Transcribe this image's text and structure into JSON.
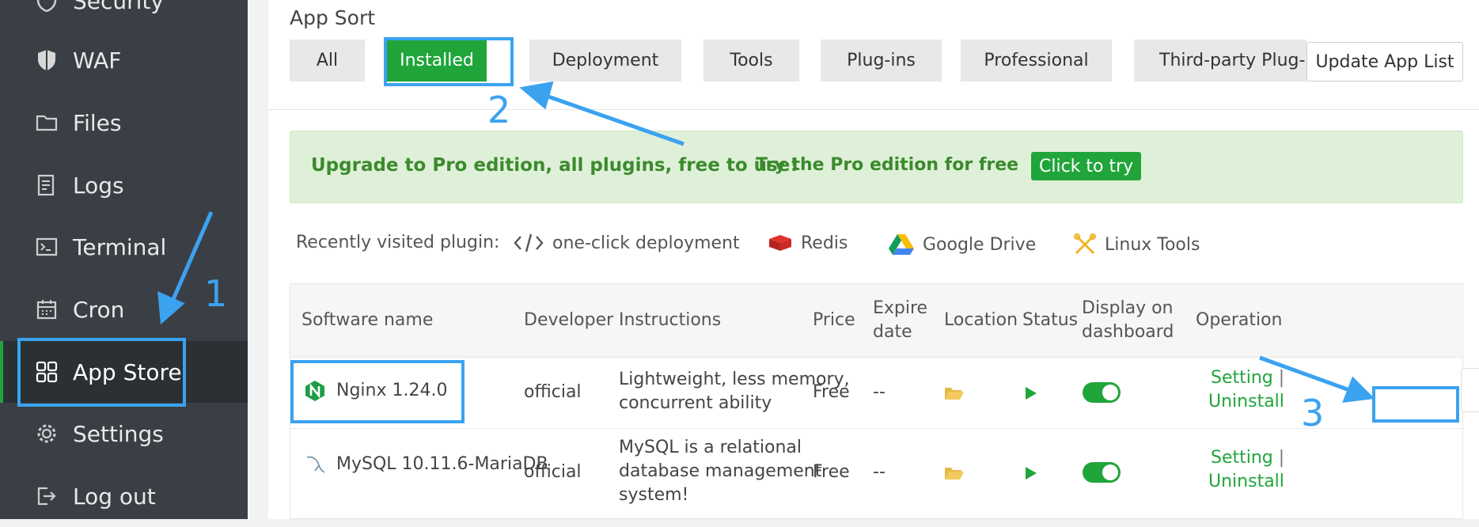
{
  "sidebar": {
    "items": [
      {
        "label": "Security",
        "icon": "shield-icon"
      },
      {
        "label": "WAF",
        "icon": "waf-shield-icon"
      },
      {
        "label": "Files",
        "icon": "folder-icon"
      },
      {
        "label": "Logs",
        "icon": "log-icon"
      },
      {
        "label": "Terminal",
        "icon": "terminal-icon"
      },
      {
        "label": "Cron",
        "icon": "calendar-icon"
      },
      {
        "label": "App Store",
        "icon": "grid-icon",
        "active": true
      },
      {
        "label": "Settings",
        "icon": "gear-icon"
      },
      {
        "label": "Log out",
        "icon": "logout-icon"
      }
    ]
  },
  "app_sort": {
    "title": "App Sort",
    "categories": [
      "All",
      "Installed",
      "Deployment",
      "Tools",
      "Plug-ins",
      "Professional",
      "Third-party Plug-in"
    ],
    "active_category": "Installed",
    "update_label": "Update App List"
  },
  "promo": {
    "headline": "Upgrade to Pro edition, all plugins, free to use!",
    "subtext": "Try the Pro edition for free",
    "button": "Click to try"
  },
  "recent": {
    "label": "Recently visited plugin:",
    "items": [
      {
        "name": "one-click deployment",
        "icon": "code-icon"
      },
      {
        "name": "Redis",
        "icon": "redis-icon"
      },
      {
        "name": "Google Drive",
        "icon": "google-drive-icon"
      },
      {
        "name": "Linux Tools",
        "icon": "tools-icon"
      }
    ]
  },
  "table": {
    "headers": {
      "name": "Software name",
      "developer": "Developer",
      "instructions": "Instructions",
      "price": "Price",
      "expire_1": "Expire",
      "expire_2": "date",
      "location": "Location",
      "status": "Status",
      "display_1": "Display on",
      "display_2": "dashboard",
      "operation": "Operation"
    },
    "rows": [
      {
        "name": "Nginx 1.24.0",
        "icon": "nginx-icon",
        "developer": "official",
        "instructions_1": "Lightweight, less memory,",
        "instructions_2": "concurrent ability",
        "instructions_3": "",
        "price": "Free",
        "expire": "--",
        "display_on": true,
        "op_setting": "Setting",
        "op_sep": "|",
        "op_uninstall": "Uninstall"
      },
      {
        "name": "MySQL 10.11.6-MariaDB",
        "icon": "mysql-icon",
        "developer": "official",
        "instructions_1": "MySQL is a relational",
        "instructions_2": "database management",
        "instructions_3": "system!",
        "price": "Free",
        "expire": "--",
        "display_on": true,
        "op_setting": "Setting",
        "op_sep": "|",
        "op_uninstall": "Uninstall"
      }
    ]
  },
  "annotations": {
    "step1": "1",
    "step2": "2",
    "step3": "3"
  },
  "colors": {
    "accent": "#20a53a",
    "annotation": "#3ba2f0",
    "sidebar_bg": "#3a3f45"
  }
}
